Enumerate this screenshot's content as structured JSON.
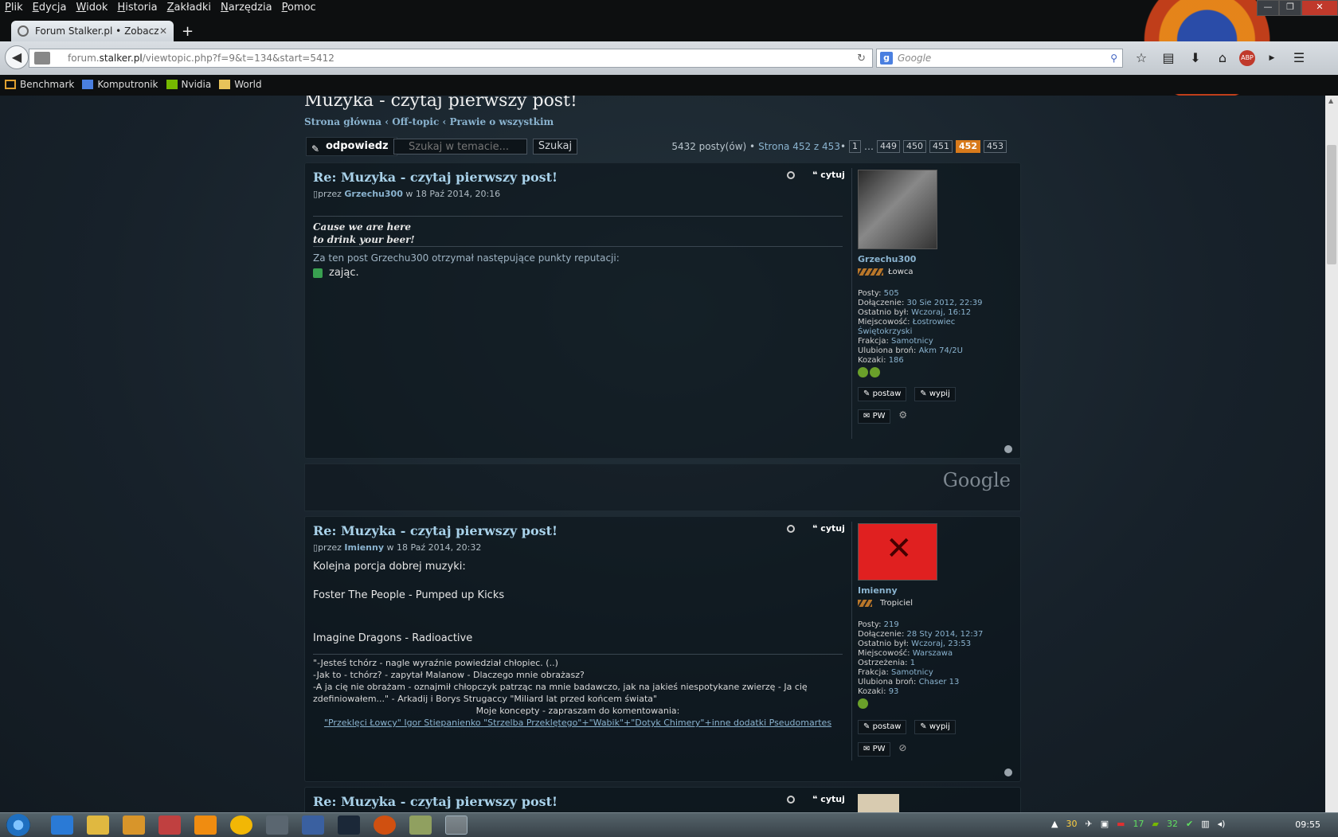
{
  "menu": [
    "Plik",
    "Edycja",
    "Widok",
    "Historia",
    "Zakładki",
    "Narzędzia",
    "Pomoc"
  ],
  "tab": {
    "label": "Forum Stalker.pl • Zobacz t...",
    "close": "✕"
  },
  "newtab": "+",
  "url": {
    "prefix": "forum.",
    "domain": "stalker.pl",
    "path": "/viewtopic.php?f=9&t=134&start=5412"
  },
  "search_placeholder": "Google",
  "bookmarks": [
    "Benchmark",
    "Komputronik",
    "Nvidia",
    "World"
  ],
  "topic": {
    "title": "Muzyka - czytaj pierwszy post!",
    "breadcrumb": "Strona główna ‹ Off-topic ‹ Prawie o wszystkim"
  },
  "actions": {
    "reply": "odpowiedz",
    "search_placeholder": "Szukaj w temacie...",
    "search_button": "Szukaj"
  },
  "pagination": {
    "summary": "5432 posty(ów) • ",
    "page_label": "Strona 452 z 453",
    "bullet": " •",
    "first": "1",
    "ellipsis": "…",
    "pages": [
      "449",
      "450",
      "451"
    ],
    "current": "452",
    "next": "453"
  },
  "posts": [
    {
      "title": "Re: Muzyka - czytaj pierwszy post!",
      "by": "przez",
      "author": "Grzechu300",
      "date": "w 18 Paź 2014, 20:16",
      "quote": "cytuj",
      "signature_line1": "Cause we are here",
      "signature_line2": "to drink your beer!",
      "reputation_header": "Za ten post Grzechu300 otrzymał następujące punkty reputacji:",
      "reputation_user": "zając.",
      "profile": {
        "name": "Grzechu300",
        "rank": "Łowca",
        "posts_label": "Posty:",
        "posts": "505",
        "joined_label": "Dołączenie:",
        "joined": "30 Sie 2012, 22:39",
        "last_label": "Ostatnio był:",
        "last": "Wczoraj, 16:12",
        "city_label": "Miejscowość:",
        "city": "Łostrowiec Świętokrzyski",
        "faction_label": "Frakcja:",
        "faction": "Samotnicy",
        "weapon_label": "Ulubiona broń:",
        "weapon": "Akm 74/2U",
        "kozaki_label": "Kozaki:",
        "kozaki": "186"
      },
      "buttons": {
        "give": "postaw",
        "drink": "wypij",
        "pm": "PW"
      }
    },
    {
      "title": "Re: Muzyka - czytaj pierwszy post!",
      "by": "przez",
      "author": "Imienny",
      "date": "w 18 Paź 2014, 20:32",
      "quote": "cytuj",
      "body_line1": "Kolejna porcja dobrej muzyki:",
      "body_line2": "Foster The People - Pumped up Kicks",
      "body_line3": "Imagine Dragons - Radioactive",
      "sig_line1": "\"-Jesteś tchórz - nagle wyraźnie powiedział chłopiec. (..)",
      "sig_line2": "-Jak to - tchórz? - zapytał Malanow - Dlaczego mnie obrażasz?",
      "sig_line3": "-A ja cię nie obrażam - oznajmił chłopczyk patrząc na mnie badawczo, jak na jakieś niespotykane zwierzę - Ja cię zdefiniowałem...\" - Arkadij i Borys Strugaccy \"Miliard lat przed końcem świata\"",
      "sig_line4": "Moje koncepty - zapraszam do komentowania:",
      "sig_links": [
        "\"Przeklęci Łowcy\"",
        "Igor Stiepanienko",
        "\"Strzelba Przeklętego\"+\"Wabik\"+\"Dotyk Chimery\"+inne dodatki",
        "Pseudomartes"
      ],
      "profile": {
        "name": "Imienny",
        "rank": "Tropiciel",
        "posts_label": "Posty:",
        "posts": "219",
        "joined_label": "Dołączenie:",
        "joined": "28 Sty 2014, 12:37",
        "last_label": "Ostatnio był:",
        "last": "Wczoraj, 23:53",
        "city_label": "Miejscowość:",
        "city": "Warszawa",
        "warn_label": "Ostrzeżenia:",
        "warn": "1",
        "faction_label": "Frakcja:",
        "faction": "Samotnicy",
        "weapon_label": "Ulubiona broń:",
        "weapon": "Chaser 13",
        "kozaki_label": "Kozaki:",
        "kozaki": "93"
      },
      "buttons": {
        "give": "postaw",
        "drink": "wypij",
        "pm": "PW"
      }
    },
    {
      "title": "Re: Muzyka - czytaj pierwszy post!",
      "quote": "cytuj"
    }
  ],
  "ad_label": "Google",
  "tray": {
    "temp1": "30",
    "temp2": "17",
    "temp3": "32"
  },
  "clock": "09:55",
  "colors": {
    "accent_link": "#8ab3cf",
    "current_page": "#d87a1b",
    "post_title": "#a9d2ea"
  }
}
